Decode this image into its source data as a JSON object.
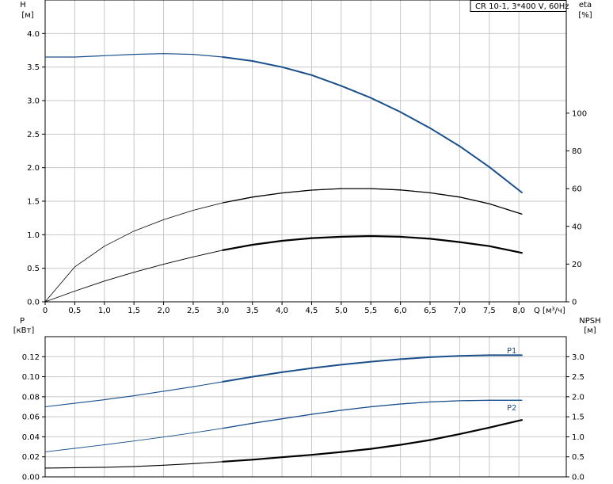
{
  "chart_data": [
    {
      "type": "line",
      "title": "CR 10-1, 3*400 V, 60Hz",
      "xlabel": "Q [м³/ч]",
      "ylabel": "H",
      "ylabel_unit": "[м]",
      "ylabel_right": "eta",
      "ylabel_right_unit": "[%]",
      "xlim": [
        0,
        8.8
      ],
      "ylim": [
        0,
        4.5
      ],
      "ylim_right": [
        0,
        160
      ],
      "grid": true,
      "x_ticks": [
        "0",
        "0,5",
        "1,0",
        "1,5",
        "2,0",
        "2,5",
        "3,0",
        "3,5",
        "4,0",
        "4,5",
        "5,0",
        "5,5",
        "6,0",
        "6,5",
        "7,0",
        "7,5",
        "8,0"
      ],
      "y_ticks": [
        "0.0",
        "0.5",
        "1.0",
        "1.5",
        "2.0",
        "2.5",
        "3.0",
        "3.5",
        "4.0"
      ],
      "y_right_ticks": [
        "0",
        "20",
        "40",
        "60",
        "80",
        "100"
      ],
      "series": [
        {
          "axis": "left",
          "color": "#1a4f8c",
          "x": [
            0,
            0.5,
            1,
            1.5,
            2,
            2.5,
            3,
            3.5,
            4,
            4.5,
            5,
            5.5,
            6,
            6.5,
            7,
            7.5,
            8.05
          ],
          "values": [
            3.65,
            3.65,
            3.67,
            3.69,
            3.7,
            3.69,
            3.65,
            3.59,
            3.5,
            3.38,
            3.22,
            3.04,
            2.83,
            2.59,
            2.32,
            2.01,
            1.63
          ]
        },
        {
          "axis": "right",
          "color": "#000000",
          "x": [
            0,
            0.5,
            1,
            1.5,
            2,
            2.5,
            3,
            3.5,
            4,
            4.5,
            5,
            5.5,
            6,
            6.5,
            7,
            7.5,
            8.05
          ],
          "values": [
            0,
            18.5,
            29.5,
            37.5,
            43.5,
            48.5,
            52.5,
            55.5,
            57.7,
            59.2,
            60.0,
            60.0,
            59.3,
            57.8,
            55.5,
            52.0,
            46.5
          ]
        },
        {
          "axis": "left",
          "color": "#000000",
          "x": [
            0,
            0.5,
            1,
            1.5,
            2,
            2.5,
            3,
            3.5,
            4,
            4.5,
            5,
            5.5,
            6,
            6.5,
            7,
            7.5,
            8.05
          ],
          "values": [
            0,
            0.16,
            0.31,
            0.44,
            0.56,
            0.67,
            0.77,
            0.85,
            0.91,
            0.95,
            0.97,
            0.98,
            0.97,
            0.94,
            0.89,
            0.83,
            0.73
          ]
        }
      ]
    },
    {
      "type": "line",
      "ylabel": "P",
      "ylabel_unit": "[кВт]",
      "ylabel_right": "NPSH",
      "ylabel_right_unit": "[м]",
      "xlim": [
        0,
        8.8
      ],
      "ylim": [
        0,
        0.14
      ],
      "ylim_right": [
        0,
        3.5
      ],
      "grid": true,
      "y_ticks": [
        "0.00",
        "0.02",
        "0.04",
        "0.06",
        "0.08",
        "0.10",
        "0.12"
      ],
      "y_right_ticks": [
        "0.0",
        "0.5",
        "1.0",
        "1.5",
        "2.0",
        "2.5",
        "3.0"
      ],
      "series": [
        {
          "name": "P1",
          "axis": "left",
          "color": "#1a4f8c",
          "x": [
            0,
            0.5,
            1,
            1.5,
            2,
            2.5,
            3,
            3.5,
            4,
            4.5,
            5,
            5.5,
            6,
            6.5,
            7,
            7.5,
            8.05
          ],
          "values": [
            0.07,
            0.0735,
            0.077,
            0.081,
            0.0855,
            0.09,
            0.095,
            0.1,
            0.1045,
            0.1085,
            0.112,
            0.115,
            0.1175,
            0.1195,
            0.1208,
            0.1215,
            0.1215
          ]
        },
        {
          "name": "P2",
          "axis": "left",
          "color": "#1a4f8c",
          "x": [
            0,
            0.5,
            1,
            1.5,
            2,
            2.5,
            3,
            3.5,
            4,
            4.5,
            5,
            5.5,
            6,
            6.5,
            7,
            7.5,
            8.05
          ],
          "values": [
            0.025,
            0.0285,
            0.032,
            0.0358,
            0.0398,
            0.044,
            0.0485,
            0.0535,
            0.058,
            0.0625,
            0.0665,
            0.07,
            0.0728,
            0.0748,
            0.076,
            0.0765,
            0.0765
          ]
        },
        {
          "axis": "right",
          "color": "#000000",
          "x": [
            0,
            0.5,
            1,
            1.5,
            2,
            2.5,
            3,
            3.5,
            4,
            4.5,
            5,
            5.5,
            6,
            6.5,
            7,
            7.5,
            8.05
          ],
          "values": [
            0.22,
            0.23,
            0.24,
            0.26,
            0.29,
            0.33,
            0.38,
            0.43,
            0.49,
            0.55,
            0.62,
            0.7,
            0.8,
            0.92,
            1.07,
            1.23,
            1.42
          ]
        }
      ]
    }
  ]
}
